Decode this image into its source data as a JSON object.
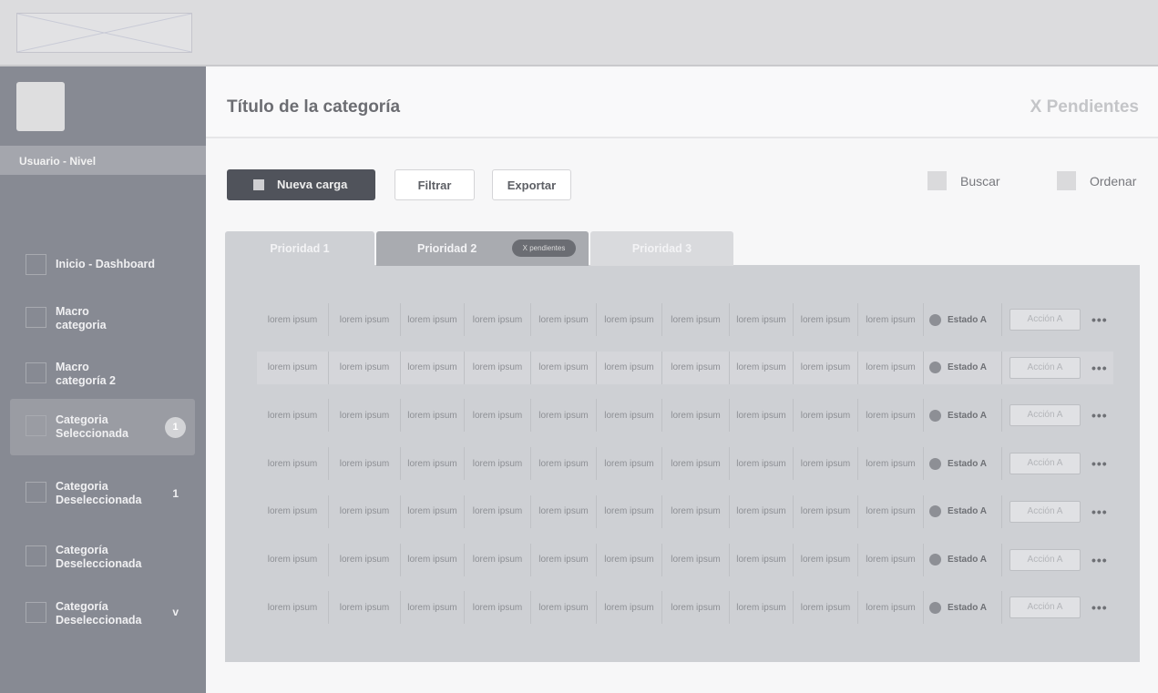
{
  "sidebar": {
    "user": "Usuario - Nivel",
    "items": [
      {
        "label1": "Inicio - Dashboard",
        "label2": ""
      },
      {
        "label1": "Macro",
        "label2": "categoria"
      },
      {
        "label1": "Macro",
        "label2": "categoría 2"
      },
      {
        "label1": "Categoria",
        "label2": "Seleccionada",
        "badge": "1"
      },
      {
        "label1": "Categoria",
        "label2": "Deseleccionada",
        "count": "1"
      },
      {
        "label1": "Categoría",
        "label2": "Deseleccionada"
      },
      {
        "label1": "Categoría",
        "label2": "Deseleccionada",
        "chevron": "v"
      }
    ]
  },
  "header": {
    "title": "Título de la categoría",
    "pending": "X Pendientes"
  },
  "toolbar": {
    "new": "Nueva carga",
    "filter": "Filtrar",
    "export": "Exportar",
    "search": "Buscar",
    "sort": "Ordenar"
  },
  "tabs": [
    {
      "label": "Prioridad 1"
    },
    {
      "label": "Prioridad 2",
      "pill": "X pendientes"
    },
    {
      "label": "Prioridad 3"
    }
  ],
  "table": {
    "rows": [
      {
        "cells": [
          "lorem ipsum",
          "lorem ipsum",
          "lorem ipsum",
          "lorem ipsum",
          "lorem ipsum",
          "lorem ipsum",
          "lorem ipsum",
          "lorem ipsum",
          "lorem ipsum",
          "lorem ipsum"
        ],
        "status": "Estado A",
        "action": "Acción A"
      },
      {
        "cells": [
          "lorem ipsum",
          "lorem ipsum",
          "lorem ipsum",
          "lorem ipsum",
          "lorem ipsum",
          "lorem ipsum",
          "lorem ipsum",
          "lorem ipsum",
          "lorem ipsum",
          "lorem ipsum"
        ],
        "status": "Estado A",
        "action": "Acción A"
      },
      {
        "cells": [
          "lorem ipsum",
          "lorem ipsum",
          "lorem ipsum",
          "lorem ipsum",
          "lorem ipsum",
          "lorem ipsum",
          "lorem ipsum",
          "lorem ipsum",
          "lorem ipsum",
          "lorem ipsum"
        ],
        "status": "Estado A",
        "action": "Acción A"
      },
      {
        "cells": [
          "lorem ipsum",
          "lorem ipsum",
          "lorem ipsum",
          "lorem ipsum",
          "lorem ipsum",
          "lorem ipsum",
          "lorem ipsum",
          "lorem ipsum",
          "lorem ipsum",
          "lorem ipsum"
        ],
        "status": "Estado A",
        "action": "Acción A"
      },
      {
        "cells": [
          "lorem ipsum",
          "lorem ipsum",
          "lorem ipsum",
          "lorem ipsum",
          "lorem ipsum",
          "lorem ipsum",
          "lorem ipsum",
          "lorem ipsum",
          "lorem ipsum",
          "lorem ipsum"
        ],
        "status": "Estado A",
        "action": "Acción A"
      },
      {
        "cells": [
          "lorem ipsum",
          "lorem ipsum",
          "lorem ipsum",
          "lorem ipsum",
          "lorem ipsum",
          "lorem ipsum",
          "lorem ipsum",
          "lorem ipsum",
          "lorem ipsum",
          "lorem ipsum"
        ],
        "status": "Estado A",
        "action": "Acción A"
      },
      {
        "cells": [
          "lorem ipsum",
          "lorem ipsum",
          "lorem ipsum",
          "lorem ipsum",
          "lorem ipsum",
          "lorem ipsum",
          "lorem ipsum",
          "lorem ipsum",
          "lorem ipsum",
          "lorem ipsum"
        ],
        "status": "Estado A",
        "action": "Acción A"
      }
    ],
    "more": "•••"
  }
}
